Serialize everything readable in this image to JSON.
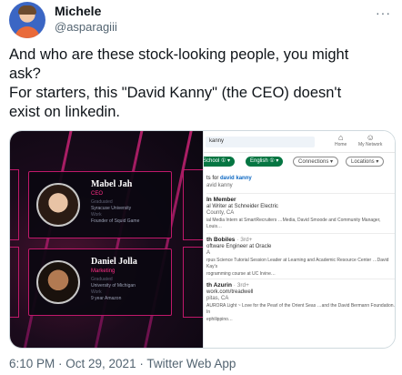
{
  "tweet": {
    "author_name": "Michele",
    "author_handle": "@asparagiii",
    "more_label": "···",
    "text_lines": [
      "And who are these stock-looking people, you might",
      "ask?",
      "For starters, this \"David Kanny\" (the CEO) doesn't",
      "exist on linkedin."
    ],
    "meta": "6:10 PM · Oct 29, 2021 · Twitter Web App"
  },
  "left_image": {
    "cards": [
      {
        "name": "Mabel Jah",
        "role": "CEO",
        "lines": [
          "Graduated",
          "Syracuse University",
          "Work",
          "Founder of Squid Game"
        ]
      },
      {
        "name": "Daniel Jolla",
        "role": "Marketing",
        "lines": [
          "Graduated",
          "University of Michigan",
          "Work",
          "9 year Amazon"
        ]
      }
    ]
  },
  "right_image": {
    "search_value": "kanny",
    "nav": [
      {
        "icon": "home-icon",
        "glyph": "⌂",
        "label": "Home"
      },
      {
        "icon": "network-icon",
        "glyph": "☺",
        "label": "My Network"
      }
    ],
    "filters": [
      {
        "label": "School ① ▾",
        "style": "green"
      },
      {
        "label": "English ① ▾",
        "style": "green"
      },
      {
        "label": "Connections ▾",
        "style": "grey"
      },
      {
        "label": "Locations ▾",
        "style": "grey"
      }
    ],
    "results_header": "ts for david kanny",
    "results_sub": "avid kanny",
    "results_query": "david kanny",
    "results": [
      {
        "name": "In Member",
        "degree": "",
        "lines": [
          "al Writer at Schneider Electric",
          "County, CA",
          "ial Media Intern at SmartRecruiters …Media, David Smoode and Community Manager, Louis…"
        ]
      },
      {
        "name": "th Bobiles",
        "degree": "· 3rd+",
        "lines": [
          "oftware Engineer at Oracle",
          "A",
          "rpus Science Tutorial Session Leader at Learning and Academic Resource Center …David Kay's",
          "rogramming course at UC Irvine…"
        ]
      },
      {
        "name": "th Azurin",
        "degree": "· 3rd+",
        "lines": [
          "work.com/treadwell",
          "pitas, CA",
          "AURORA Light ~ Love for the Pearl of the Orient Seas …and the David Bermann Foundation. In",
          "ephilippino…"
        ]
      }
    ]
  }
}
